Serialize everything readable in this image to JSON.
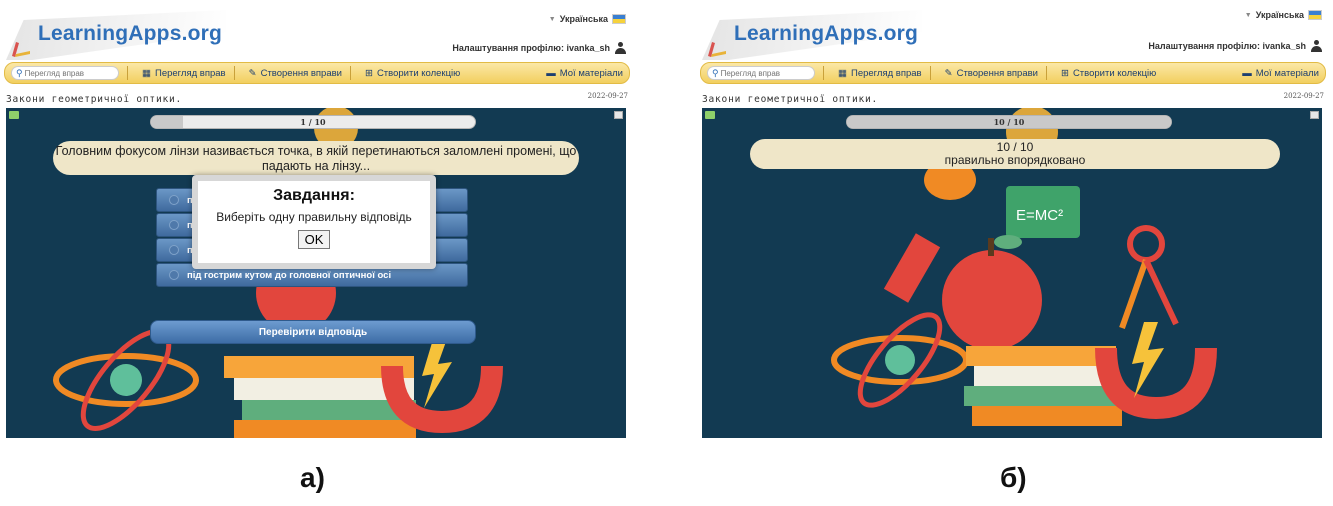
{
  "panels": [
    {
      "logo": "LearningApps.org",
      "language": "Українська",
      "profile": "Налаштування профілю: ivanka_sh",
      "search_placeholder": "Перегляд вправ",
      "nav": {
        "browse": "Перегляд вправ",
        "create": "Створення вправи",
        "collection": "Створити колекцію",
        "materials": "Мої матеріали"
      },
      "exercise_title": "Закони геометричної оптики.",
      "date": "2022-09-27",
      "progress_text": "1 / 10",
      "progress_value": 0.1,
      "question": "Головним фокусом лінзи називається точка, в якій перетинаються заломлені промені, що падають на лінзу...",
      "options_visible": [
        "п",
        "п",
        "п",
        "під гострим кутом до головної оптичної осі"
      ],
      "check_button": "Перевірити відповідь",
      "dialog": {
        "title": "Завдання:",
        "text": "Виберіть одну правильну відповідь",
        "ok": "OK"
      }
    },
    {
      "logo": "LearningApps.org",
      "language": "Українська",
      "profile": "Налаштування профілю: ivanka_sh",
      "search_placeholder": "Перегляд вправ",
      "nav": {
        "browse": "Перегляд вправ",
        "create": "Створення вправи",
        "collection": "Створити колекцію",
        "materials": "Мої матеріали"
      },
      "exercise_title": "Закони геометричної оптики.",
      "date": "2022-09-27",
      "progress_text": "10 / 10",
      "progress_value": 1.0,
      "result_score": "10 / 10",
      "result_text": "правильно впорядковано",
      "board_formula": "E=MC²"
    }
  ],
  "captions": [
    "а)",
    "б)"
  ],
  "colors": {
    "stage_bg": "#123a52",
    "toolbar": "#f2cf5f",
    "logo_blue": "#2f6fb8",
    "bubble": "#efe6c8",
    "option_blue": "#4a76aa"
  }
}
